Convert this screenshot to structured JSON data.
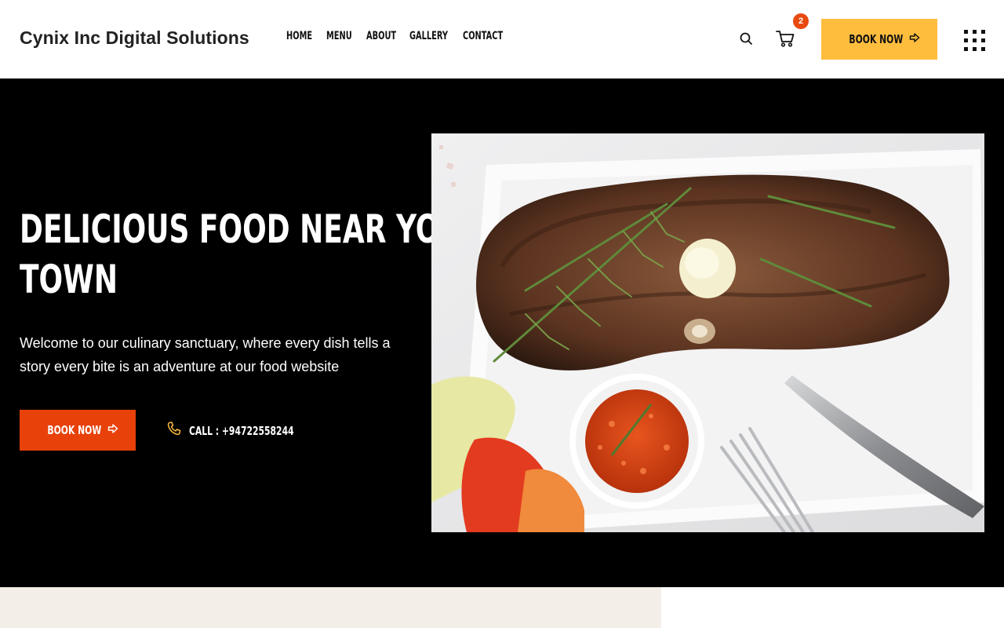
{
  "brand": {
    "name": "Cynix Inc Digital Solutions"
  },
  "nav": {
    "items": [
      "HOME",
      "MENU",
      "ABOUT",
      "GALLERY",
      "CONTACT"
    ]
  },
  "header": {
    "cart_count": "2",
    "book_label": "BOOK NOW",
    "icons": [
      "search-icon",
      "cart-icon",
      "arrow-right-icon",
      "grid-menu-icon"
    ]
  },
  "hero": {
    "title_line1": "DELICIOUS FOOD NEAR YOUR",
    "title_line2": "TOWN",
    "description": "Welcome to our culinary sanctuary, where every dish tells a story every bite is an adventure at our food website",
    "book_label": "BOOK NOW",
    "call_label": "CALL : +94722558244",
    "image": "grilled-steak-with-rosemary-salsa-and-cutlery-photo"
  },
  "colors": {
    "accent_yellow": "#ffbd3e",
    "accent_orange": "#e8410a",
    "badge": "#e84a10",
    "hero_bg": "#000000",
    "bottom_beige": "#f3efe8"
  }
}
